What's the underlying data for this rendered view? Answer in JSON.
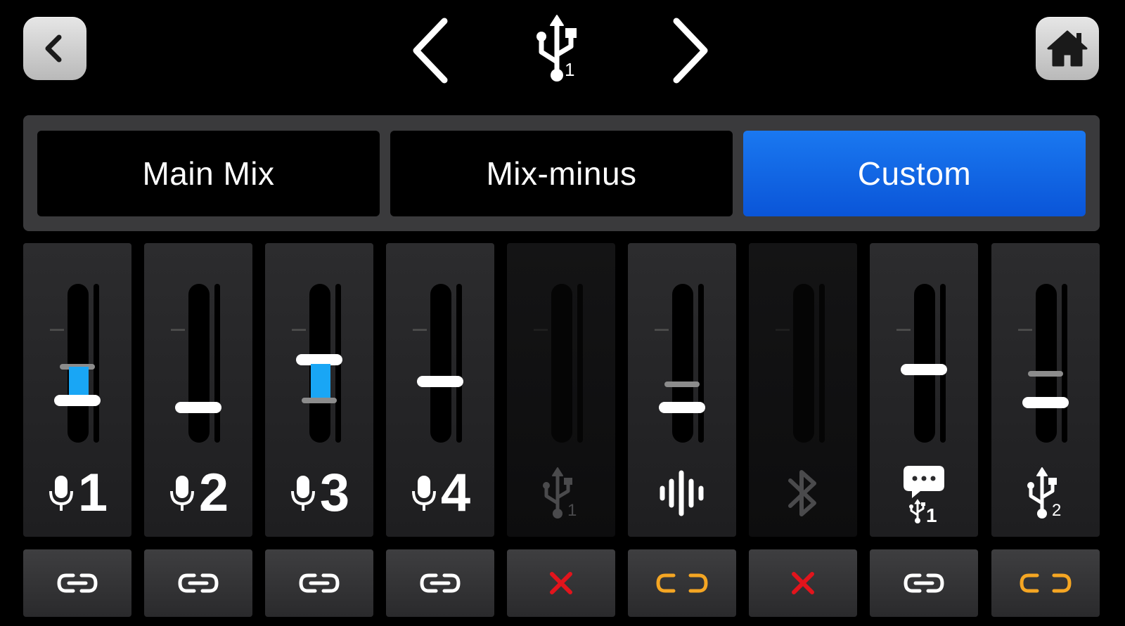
{
  "header": {
    "back_icon": "chevron-left-icon",
    "home_icon": "home-icon",
    "prev_icon": "chevron-left-icon",
    "next_icon": "chevron-right-icon",
    "source_icon": "usb-icon",
    "source_index": "1"
  },
  "tabs": [
    {
      "label": "Main Mix",
      "active": false
    },
    {
      "label": "Mix-minus",
      "active": false
    },
    {
      "label": "Custom",
      "active": true
    }
  ],
  "colors": {
    "accent": "#0a63e6",
    "fader_fill": "#19a6f5",
    "link_unlinked": "#f5a623",
    "link_disabled": "#e2141c"
  },
  "channels": [
    {
      "icon": "mic-icon",
      "number": "1",
      "enabled": true,
      "link": "linked"
    },
    {
      "icon": "mic-icon",
      "number": "2",
      "enabled": true,
      "link": "linked"
    },
    {
      "icon": "mic-icon",
      "number": "3",
      "enabled": true,
      "link": "linked"
    },
    {
      "icon": "mic-icon",
      "number": "4",
      "enabled": true,
      "link": "linked"
    },
    {
      "icon": "usb-icon",
      "sub": "1",
      "enabled": false,
      "link": "disabled"
    },
    {
      "icon": "sound-pads-icon",
      "enabled": true,
      "link": "unlinked"
    },
    {
      "icon": "bluetooth-icon",
      "enabled": false,
      "link": "disabled"
    },
    {
      "icon": "chat-usb-icon",
      "sub": "1",
      "enabled": true,
      "link": "linked"
    },
    {
      "icon": "usb-icon",
      "sub": "2",
      "enabled": true,
      "link": "unlinked"
    }
  ]
}
